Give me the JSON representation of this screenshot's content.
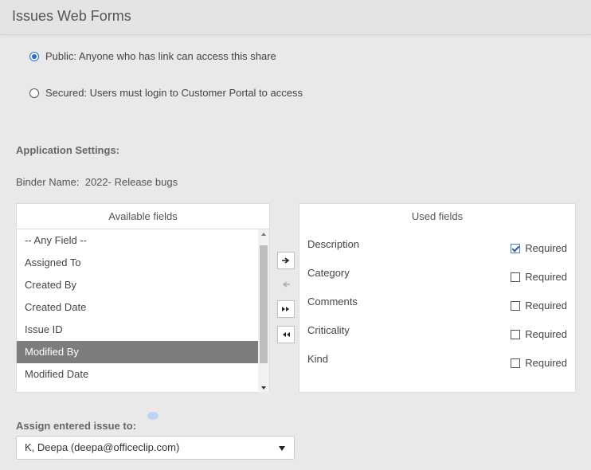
{
  "header": {
    "title": "Issues Web Forms"
  },
  "access": {
    "public_label": "Public: Anyone who has link can access this share",
    "secured_label": "Secured: Users must login to Customer Portal to access",
    "selected": "public"
  },
  "settings": {
    "heading": "Application Settings:",
    "binder_label": "Binder Name:",
    "binder_value": "2022- Release bugs"
  },
  "available": {
    "title": "Available fields",
    "items": [
      {
        "label": "-- Any Field --",
        "selected": false
      },
      {
        "label": "Assigned To",
        "selected": false
      },
      {
        "label": "Created By",
        "selected": false
      },
      {
        "label": "Created Date",
        "selected": false
      },
      {
        "label": "Issue ID",
        "selected": false
      },
      {
        "label": "Modified By",
        "selected": true
      },
      {
        "label": "Modified Date",
        "selected": false
      }
    ]
  },
  "move_buttons": {
    "add_icon": "arrow-right-icon",
    "remove_icon": "arrow-left-icon",
    "add_all_icon": "double-arrow-right-icon",
    "remove_all_icon": "double-arrow-left-icon"
  },
  "used": {
    "title": "Used fields",
    "required_label": "Required",
    "items": [
      {
        "label": "Description",
        "required": true
      },
      {
        "label": "Category",
        "required": false
      },
      {
        "label": "Comments",
        "required": false
      },
      {
        "label": "Criticality",
        "required": false
      },
      {
        "label": "Kind",
        "required": false
      }
    ]
  },
  "assign": {
    "label": "Assign entered issue to:",
    "value": "K, Deepa (deepa@officeclip.com)"
  },
  "colors": {
    "accent": "#1e6fd0",
    "selected_row": "#7d7d7d",
    "background": "#e9e9e9"
  }
}
